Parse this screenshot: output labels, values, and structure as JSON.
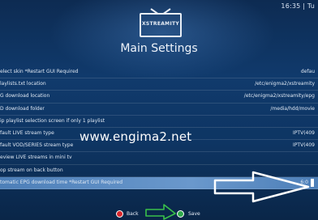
{
  "status_bar": {
    "clock": "16:35 | Tu"
  },
  "logo": {
    "text": "XSTREAMITY"
  },
  "header": {
    "title": "Main Settings"
  },
  "settings": [
    {
      "label": "elect skin *Restart GUI Required",
      "value": "defau"
    },
    {
      "label": "laylists.txt location",
      "value": "/etc/enigma2/xstreamity"
    },
    {
      "label": "G download location",
      "value": "/etc/enigma2/xstreamity/epg"
    },
    {
      "label": "D download folder",
      "value": "/media/hdd/movie"
    },
    {
      "label": "ip playlist selection screen if only 1 playlist",
      "value": ""
    },
    {
      "label": "fault LIVE stream type",
      "value": "IPTV(409"
    },
    {
      "label": "fault VOD/SERIES stream type",
      "value": "IPTV(409"
    },
    {
      "label": "eview LIVE streams in mini tv",
      "value": ""
    },
    {
      "label": "op stream on back button",
      "value": ""
    },
    {
      "label": "tomatic EPG download time *Restart GUI Required",
      "value": "6:0"
    }
  ],
  "watermark": "www.engima2.net",
  "footer": {
    "back_label": "Back",
    "save_label": "Save"
  },
  "colors": {
    "selected_row": "#6a98cc",
    "arrow": "#ffffff",
    "back_key": "#d8262b",
    "save_key": "#2ea84a"
  }
}
